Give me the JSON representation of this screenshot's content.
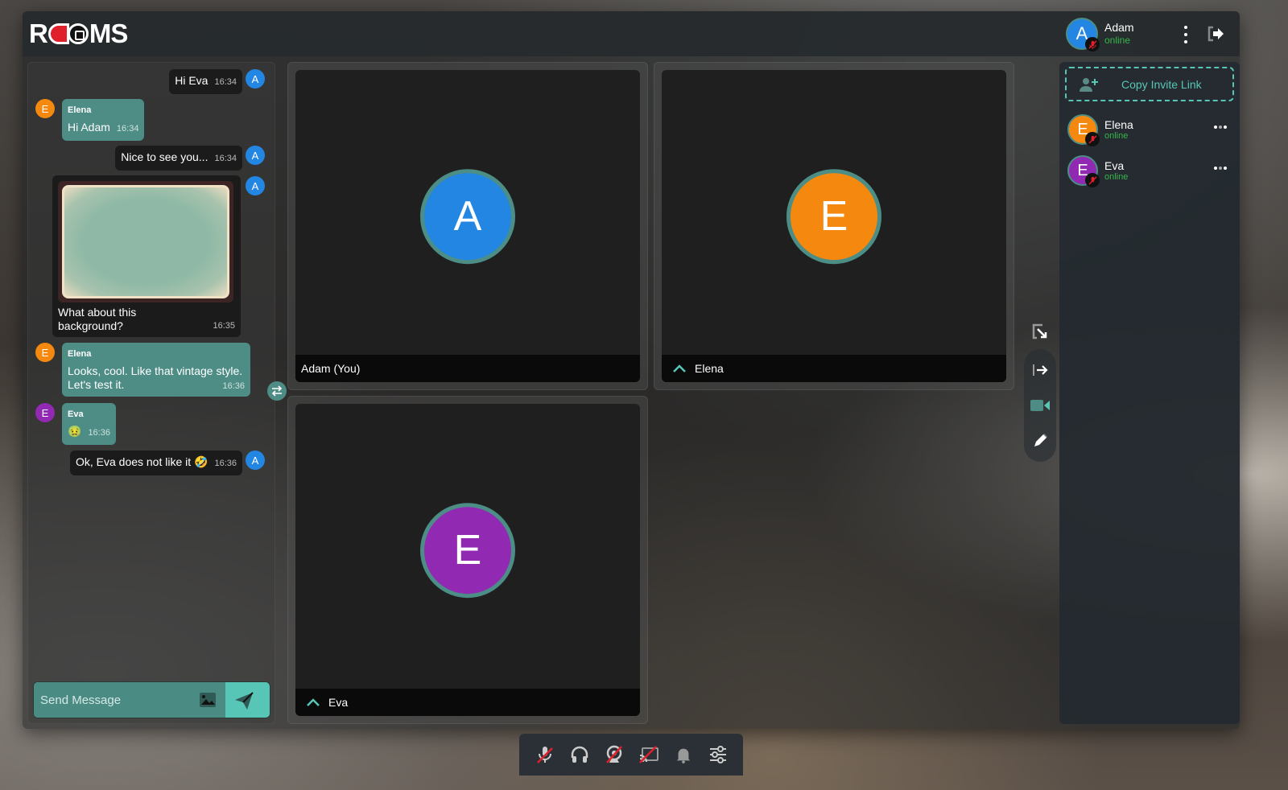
{
  "app": {
    "logo": "ROOMS"
  },
  "header": {
    "user": {
      "initial": "A",
      "name": "Adam",
      "status": "online",
      "color": "#2386e3"
    }
  },
  "chat": {
    "messages": [
      {
        "from": "Adam",
        "initial": "A",
        "text": "Hi Eva",
        "time": "16:34",
        "mine": true
      },
      {
        "from": "Elena",
        "initial": "E",
        "text": "Hi Adam",
        "time": "16:34",
        "mine": false
      },
      {
        "from": "Adam",
        "initial": "A",
        "text": "Nice to see you...",
        "time": "16:34",
        "mine": true
      },
      {
        "from": "Adam",
        "initial": "A",
        "text": "What about this background?",
        "time": "16:35",
        "mine": true,
        "image": "vintage-frame"
      },
      {
        "from": "Elena",
        "initial": "E",
        "text": "Looks, cool. Like that vintage style. Let's test it.",
        "time": "16:36",
        "mine": false
      },
      {
        "from": "Eva",
        "initial": "E",
        "text": "🤢",
        "time": "16:36",
        "mine": false
      },
      {
        "from": "Adam",
        "initial": "A",
        "text": "Ok, Eva does not like it 🤣",
        "time": "16:36",
        "mine": true
      }
    ],
    "composer": {
      "placeholder": "Send Message",
      "value": ""
    }
  },
  "video": {
    "tiles": [
      {
        "initial": "A",
        "label": "Adam (You)",
        "color": "#2386e3",
        "has_chevron": false
      },
      {
        "initial": "E",
        "label": "Elena",
        "color": "#f5890f",
        "has_chevron": true
      },
      {
        "initial": "E",
        "label": "Eva",
        "color": "#9129b3",
        "has_chevron": true
      }
    ]
  },
  "side_tools": [
    "exit-fullscreen-icon",
    "leave-icon",
    "video-camera-icon",
    "pencil-icon"
  ],
  "participants": {
    "invite_label": "Copy Invite Link",
    "list": [
      {
        "initial": "E",
        "name": "Elena",
        "status": "online",
        "color": "#f5890f"
      },
      {
        "initial": "E",
        "name": "Eva",
        "status": "online",
        "color": "#9129b3"
      }
    ]
  },
  "controls": [
    "microphone-muted",
    "headphones",
    "webcam-off",
    "screenshare-off",
    "notifications",
    "settings-sliders"
  ],
  "colors": {
    "accent": "#58c6b6",
    "bubble_them": "#4e8d86",
    "bubble_me": "#1b1b1b",
    "online": "#35b64a",
    "muted": "#e0202a"
  }
}
